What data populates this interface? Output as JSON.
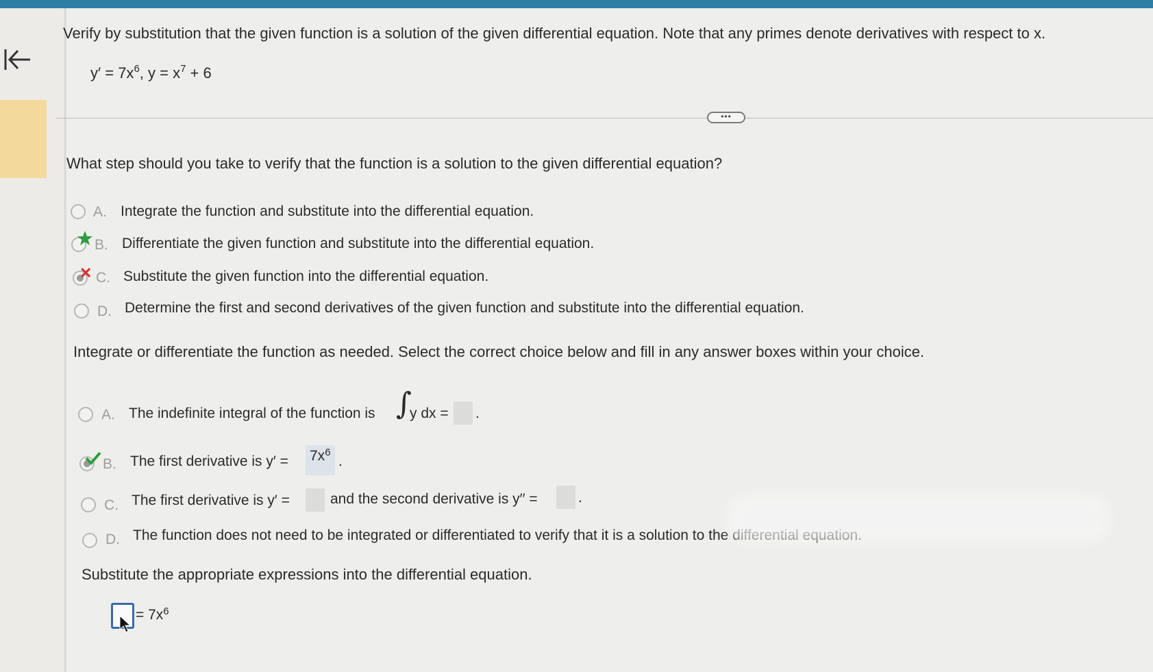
{
  "problem": {
    "prompt": "Verify by substitution that the given function is a solution of the given differential equation. Note that any primes denote derivatives with respect to x.",
    "equation_base": "y′ = 7x",
    "equation_exp1": "6",
    "equation_mid": ", y = x",
    "equation_exp2": "7",
    "equation_tail": " + 6"
  },
  "expand_button": "•••",
  "question1": {
    "text": "What step should you take to verify that the function is a solution to the given differential equation?",
    "options": [
      {
        "letter": "A.",
        "text": "Integrate the function and substitute into the differential equation."
      },
      {
        "letter": "B.",
        "text": "Differentiate the given function and substitute into the differential equation."
      },
      {
        "letter": "C.",
        "text": "Substitute the given function into the differential equation."
      },
      {
        "letter": "D.",
        "text": "Determine the first and second derivatives of the given function and substitute into the differential equation."
      }
    ]
  },
  "question2": {
    "text": "Integrate or differentiate the function as needed. Select the correct choice below and fill in any answer boxes within your choice.",
    "options": [
      {
        "letter": "A.",
        "text": "The indefinite integral of the function is",
        "after": "y dx =",
        "end": "."
      },
      {
        "letter": "B.",
        "text": "The first derivative is y′ =",
        "answer_base": "7x",
        "answer_exp": "6",
        "end": "."
      },
      {
        "letter": "C.",
        "text": "The first derivative is y′ =",
        "middle": "and the second derivative is y′′ =",
        "end": "."
      },
      {
        "letter": "D.",
        "text": "The function does not need to be integrated or differentiated to verify that it is a solution to the differential equation."
      }
    ]
  },
  "question3": {
    "text": "Substitute the appropriate expressions into the differential equation.",
    "rhs_base": "= 7x",
    "rhs_exp": "6"
  },
  "colors": {
    "accent_bar": "#2f7fa5",
    "highlight": "#f3d99c",
    "correct": "#2e9b3f",
    "incorrect": "#d72c2c",
    "input_border": "#3b6aa8"
  }
}
